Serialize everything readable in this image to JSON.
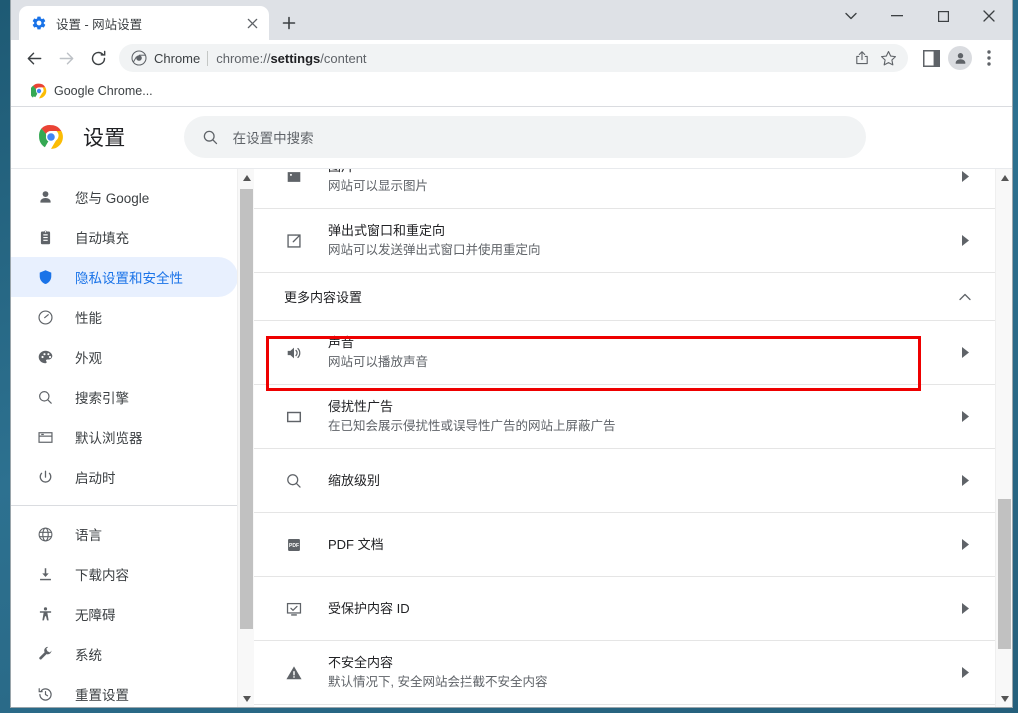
{
  "window": {
    "controls": [
      {
        "name": "tab-search-button",
        "glyph": "chevron-down-icon"
      },
      {
        "name": "minimize-button",
        "glyph": "minimize-icon"
      },
      {
        "name": "maximize-button",
        "glyph": "maximize-icon"
      },
      {
        "name": "close-window-button",
        "glyph": "close-icon"
      }
    ]
  },
  "tabs": [
    {
      "title": "设置 - 网站设置",
      "favicon": "gear-icon",
      "active": true
    }
  ],
  "newtab_label": "+",
  "toolbar": {
    "back_label": "←",
    "forward_label": "→",
    "reload_label": "⟳",
    "omnibox": {
      "chip_label": "Chrome",
      "url_scheme": "chrome://",
      "url_bold": "settings",
      "url_rest": "/content",
      "full_url": "chrome://settings/content"
    },
    "share_icon": "share-icon",
    "bookmark_icon": "star-icon",
    "sidepanel_icon": "side-panel-icon",
    "profile_icon": "avatar-icon",
    "menu_icon": "three-dot-menu-icon"
  },
  "bookmarks": [
    {
      "label": "Google Chrome...",
      "icon": "chrome-logo-icon"
    }
  ],
  "settings_header": {
    "logo": "chrome-logo-icon",
    "title": "设置",
    "search_placeholder": "在设置中搜索",
    "search_icon": "search-icon"
  },
  "sidebar": {
    "groups": [
      {
        "items": [
          {
            "label": "您与 Google",
            "icon": "person-icon",
            "selected": false
          },
          {
            "label": "自动填充",
            "icon": "clipboard-icon",
            "selected": false
          },
          {
            "label": "隐私设置和安全性",
            "icon": "shield-icon",
            "selected": true
          },
          {
            "label": "性能",
            "icon": "speedometer-icon",
            "selected": false
          },
          {
            "label": "外观",
            "icon": "palette-icon",
            "selected": false
          },
          {
            "label": "搜索引擎",
            "icon": "search-icon",
            "selected": false
          },
          {
            "label": "默认浏览器",
            "icon": "browser-window-icon",
            "selected": false
          },
          {
            "label": "启动时",
            "icon": "power-icon",
            "selected": false
          }
        ]
      },
      {
        "items": [
          {
            "label": "语言",
            "icon": "globe-icon",
            "selected": false
          },
          {
            "label": "下载内容",
            "icon": "download-icon",
            "selected": false
          },
          {
            "label": "无障碍",
            "icon": "accessibility-icon",
            "selected": false
          },
          {
            "label": "系统",
            "icon": "wrench-icon",
            "selected": false
          },
          {
            "label": "重置设置",
            "icon": "history-restore-icon",
            "selected": false
          }
        ]
      }
    ]
  },
  "content_rows": [
    {
      "kind": "row",
      "icon": "image-icon",
      "title": "图片",
      "sub": "网站可以显示图片",
      "arrow": "chevron-right-icon",
      "highlighted": false
    },
    {
      "kind": "row",
      "icon": "external-link-icon",
      "title": "弹出式窗口和重定向",
      "sub": "网站可以发送弹出式窗口并使用重定向",
      "arrow": "chevron-right-icon",
      "highlighted": false
    },
    {
      "kind": "section",
      "title": "更多内容设置",
      "arrow": "chevron-up-icon"
    },
    {
      "kind": "row",
      "icon": "speaker-icon",
      "title": "声音",
      "sub": "网站可以播放声音",
      "arrow": "chevron-right-icon",
      "highlighted": true
    },
    {
      "kind": "row",
      "icon": "ad-window-icon",
      "title": "侵扰性广告",
      "sub": "在已知会展示侵扰性或误导性广告的网站上屏蔽广告",
      "arrow": "chevron-right-icon",
      "highlighted": false
    },
    {
      "kind": "row",
      "icon": "search-icon",
      "title": "缩放级别",
      "sub": "",
      "arrow": "chevron-right-icon",
      "highlighted": false
    },
    {
      "kind": "row",
      "icon": "pdf-icon",
      "title": "PDF 文档",
      "sub": "",
      "arrow": "chevron-right-icon",
      "highlighted": false
    },
    {
      "kind": "row",
      "icon": "protected-content-icon",
      "title": "受保护内容 ID",
      "sub": "",
      "arrow": "chevron-right-icon",
      "highlighted": false
    },
    {
      "kind": "row",
      "icon": "warning-triangle-icon",
      "title": "不安全内容",
      "sub": "默认情况下, 安全网站会拦截不安全内容",
      "arrow": "chevron-right-icon",
      "highlighted": false
    }
  ],
  "colors": {
    "accent": "#1a73e8",
    "selected_bg": "#e8f0fe",
    "highlight_box": "#ee0000",
    "tabstrip_bg": "#dee1e6",
    "omnibox_bg": "#f1f3f4",
    "text_primary": "#202124",
    "text_secondary": "#5f6368",
    "desktop_bg": "#2b6076"
  },
  "scrollbars": {
    "sidebar": {
      "thumb_top_pct": 4,
      "thumb_height_pct": 80
    },
    "main": {
      "thumb_top_pct": 60,
      "thumb_height_pct": 28
    }
  }
}
